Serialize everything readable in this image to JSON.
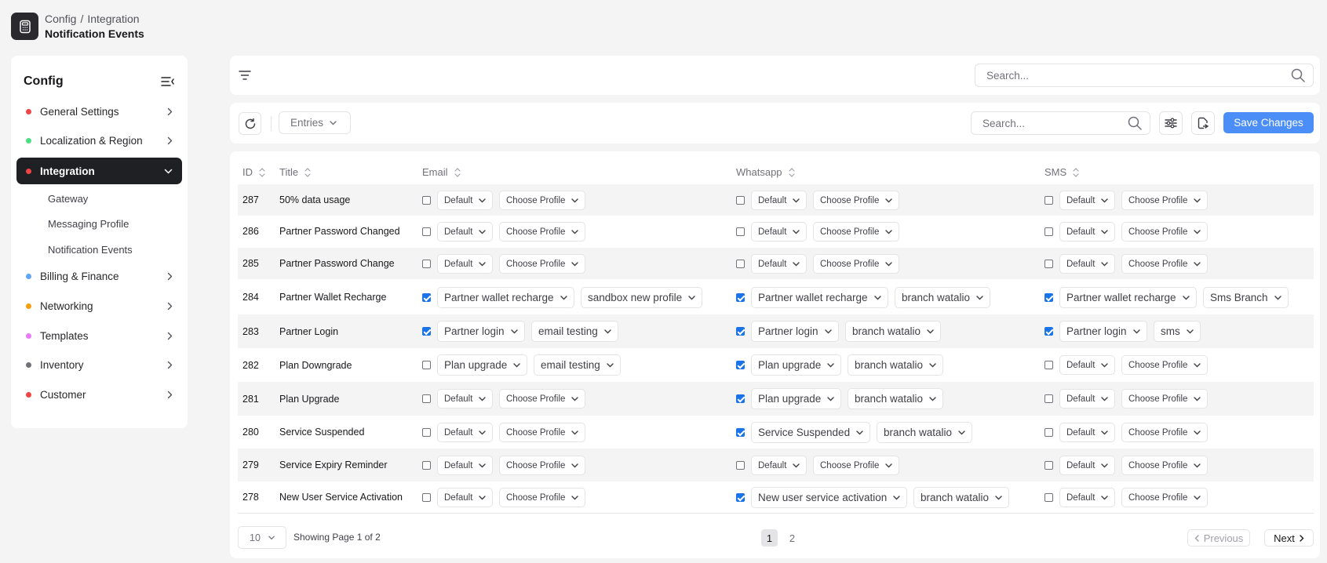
{
  "breadcrumb": {
    "items": [
      "Config",
      "Integration"
    ],
    "separator": "/",
    "current": "Notification Events"
  },
  "sidebar": {
    "title": "Config",
    "items": [
      {
        "label": "General Settings",
        "color": "#ef4444"
      },
      {
        "label": "Localization & Region",
        "color": "#4ade80"
      },
      {
        "label": "Integration",
        "color": "#ef4444",
        "active": true
      },
      {
        "label": "Billing & Finance",
        "color": "#60a5fa"
      },
      {
        "label": "Networking",
        "color": "#f59e0b"
      },
      {
        "label": "Templates",
        "color": "#e879f9"
      },
      {
        "label": "Inventory",
        "color": "#71717a"
      },
      {
        "label": "Customer",
        "color": "#ef4444"
      }
    ],
    "subitems": [
      "Gateway",
      "Messaging Profile",
      "Notification Events"
    ]
  },
  "filter": {
    "search_placeholder": "Search..."
  },
  "toolbar": {
    "entries_label": "Entries",
    "search_placeholder": "Search...",
    "save_label": "Save Changes",
    "accent": "#4c8ef7"
  },
  "table": {
    "headers": [
      "ID",
      "Title",
      "Email",
      "Whatsapp",
      "SMS"
    ],
    "rows": [
      {
        "id": "287",
        "title": "50% data usage",
        "email": {
          "checked": false,
          "template": "Default",
          "profile": "Choose Profile"
        },
        "whatsapp": {
          "checked": false,
          "template": "Default",
          "profile": "Choose Profile"
        },
        "sms": {
          "checked": false,
          "template": "Default",
          "profile": "Choose Profile"
        }
      },
      {
        "id": "286",
        "title": "Partner Password Changed",
        "email": {
          "checked": false,
          "template": "Default",
          "profile": "Choose Profile"
        },
        "whatsapp": {
          "checked": false,
          "template": "Default",
          "profile": "Choose Profile"
        },
        "sms": {
          "checked": false,
          "template": "Default",
          "profile": "Choose Profile"
        }
      },
      {
        "id": "285",
        "title": "Partner Password Change",
        "email": {
          "checked": false,
          "template": "Default",
          "profile": "Choose Profile"
        },
        "whatsapp": {
          "checked": false,
          "template": "Default",
          "profile": "Choose Profile"
        },
        "sms": {
          "checked": false,
          "template": "Default",
          "profile": "Choose Profile"
        }
      },
      {
        "id": "284",
        "title": "Partner Wallet Recharge",
        "email": {
          "checked": true,
          "template": "Partner wallet recharge",
          "profile": "sandbox new profile"
        },
        "whatsapp": {
          "checked": true,
          "template": "Partner wallet recharge",
          "profile": "branch watalio"
        },
        "sms": {
          "checked": true,
          "template": "Partner wallet recharge",
          "profile": "Sms Branch"
        }
      },
      {
        "id": "283",
        "title": "Partner Login",
        "email": {
          "checked": true,
          "template": "Partner login",
          "profile": "email testing"
        },
        "whatsapp": {
          "checked": true,
          "template": "Partner login",
          "profile": "branch watalio"
        },
        "sms": {
          "checked": true,
          "template": "Partner login",
          "profile": "sms"
        }
      },
      {
        "id": "282",
        "title": "Plan Downgrade",
        "email": {
          "checked": false,
          "template": "Plan upgrade",
          "profile": "email testing"
        },
        "whatsapp": {
          "checked": true,
          "template": "Plan upgrade",
          "profile": "branch watalio"
        },
        "sms": {
          "checked": false,
          "template": "Default",
          "profile": "Choose Profile"
        }
      },
      {
        "id": "281",
        "title": "Plan Upgrade",
        "email": {
          "checked": false,
          "template": "Default",
          "profile": "Choose Profile"
        },
        "whatsapp": {
          "checked": true,
          "template": "Plan upgrade",
          "profile": "branch watalio"
        },
        "sms": {
          "checked": false,
          "template": "Default",
          "profile": "Choose Profile"
        }
      },
      {
        "id": "280",
        "title": "Service Suspended",
        "email": {
          "checked": false,
          "template": "Default",
          "profile": "Choose Profile"
        },
        "whatsapp": {
          "checked": true,
          "template": "Service Suspended",
          "profile": "branch watalio"
        },
        "sms": {
          "checked": false,
          "template": "Default",
          "profile": "Choose Profile"
        }
      },
      {
        "id": "279",
        "title": "Service Expiry Reminder",
        "email": {
          "checked": false,
          "template": "Default",
          "profile": "Choose Profile"
        },
        "whatsapp": {
          "checked": false,
          "template": "Default",
          "profile": "Choose Profile"
        },
        "sms": {
          "checked": false,
          "template": "Default",
          "profile": "Choose Profile"
        }
      },
      {
        "id": "278",
        "title": "New User Service Activation",
        "email": {
          "checked": false,
          "template": "Default",
          "profile": "Choose Profile"
        },
        "whatsapp": {
          "checked": true,
          "template": "New user service activation",
          "profile": "branch watalio"
        },
        "sms": {
          "checked": false,
          "template": "Default",
          "profile": "Choose Profile"
        }
      }
    ]
  },
  "pagination": {
    "page_size": "10",
    "showing": "Showing Page 1 of 2",
    "pages": [
      "1",
      "2"
    ],
    "current": "1",
    "prev_label": "Previous",
    "next_label": "Next"
  }
}
